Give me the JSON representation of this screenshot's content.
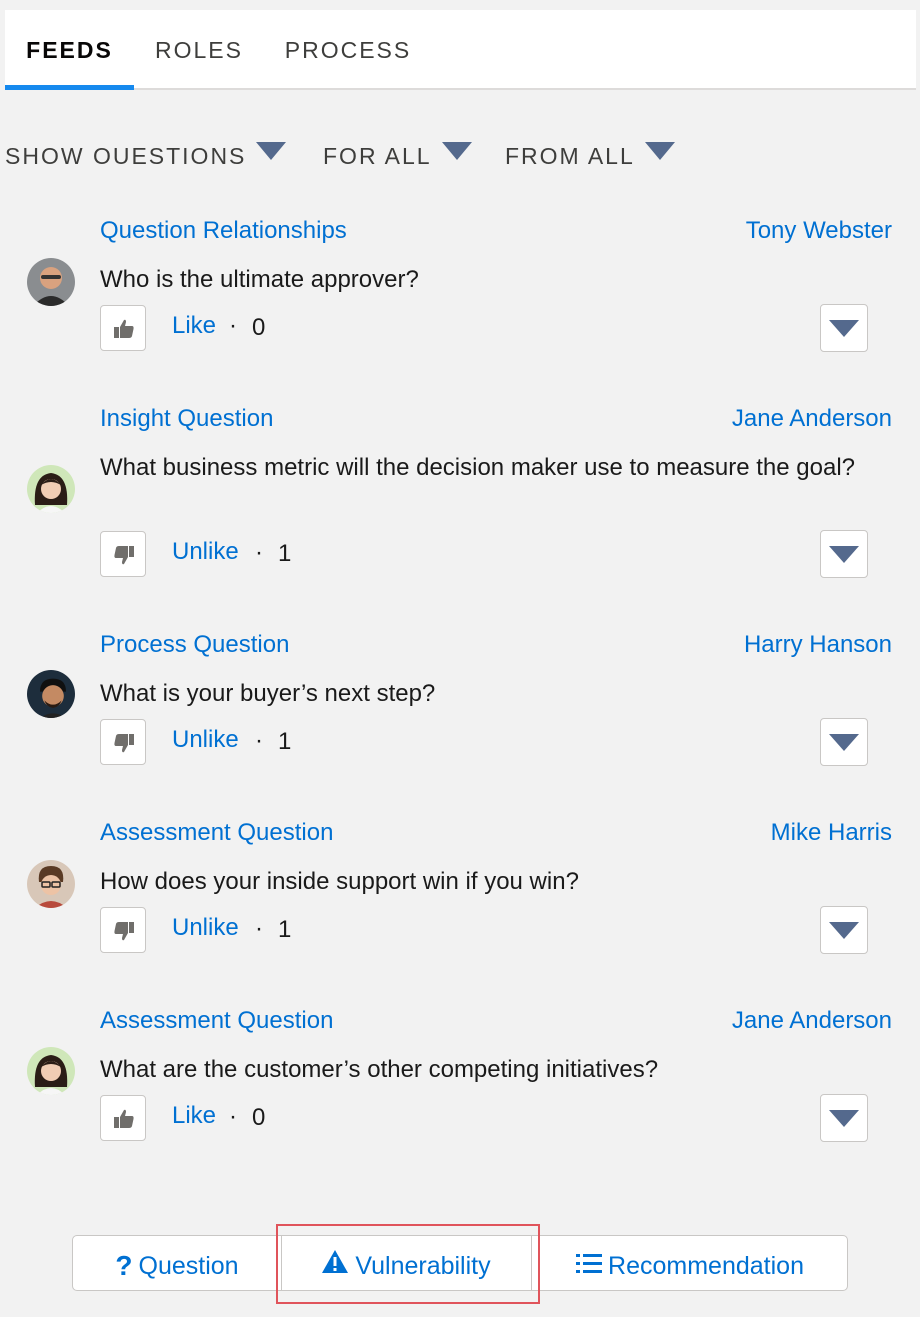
{
  "tabs": [
    {
      "label": "FEEDS",
      "active": true
    },
    {
      "label": "ROLES",
      "active": false
    },
    {
      "label": "PROCESS",
      "active": false
    }
  ],
  "filters": [
    {
      "label": "SHOW OUESTIONS"
    },
    {
      "label": "FOR ALL"
    },
    {
      "label": "FROM ALL"
    }
  ],
  "feed": [
    {
      "type": "Question Relationships",
      "author": "Tony Webster",
      "text": "Who is the ultimate approver?",
      "like_label": "Like",
      "dot": "·",
      "count": "0",
      "reaction": "thumbs-up-icon"
    },
    {
      "type": "Insight Question",
      "author": "Jane Anderson",
      "text": "What business metric will the decision maker use to measure the goal?",
      "like_label": "Unlike",
      "dot": "·",
      "count": "1",
      "reaction": "thumbs-down-icon"
    },
    {
      "type": "Process Question",
      "author": "Harry Hanson",
      "text": "What is your buyer’s next step?",
      "like_label": "Unlike",
      "dot": "·",
      "count": "1",
      "reaction": "thumbs-down-icon"
    },
    {
      "type": "Assessment Question",
      "author": "Mike Harris",
      "text": "How does your inside support win if you win?",
      "like_label": "Unlike",
      "dot": "·",
      "count": "1",
      "reaction": "thumbs-down-icon"
    },
    {
      "type": "Assessment Question",
      "author": "Jane Anderson",
      "text": "What are the customer’s other competing initiatives?",
      "like_label": "Like",
      "dot": "·",
      "count": "0",
      "reaction": "thumbs-up-icon"
    }
  ],
  "actions": {
    "question": {
      "label": "Question",
      "icon": "question-mark-icon"
    },
    "vulnerability": {
      "label": "Vulnerability",
      "icon": "warning-icon"
    },
    "recommendation": {
      "label": "Recommendation",
      "icon": "list-icon"
    }
  },
  "colors": {
    "link": "#0070d2",
    "tab_active_underline": "#1589ee",
    "caret": "#54698d",
    "highlight": "#e0545b",
    "background": "#f2f2f2"
  }
}
